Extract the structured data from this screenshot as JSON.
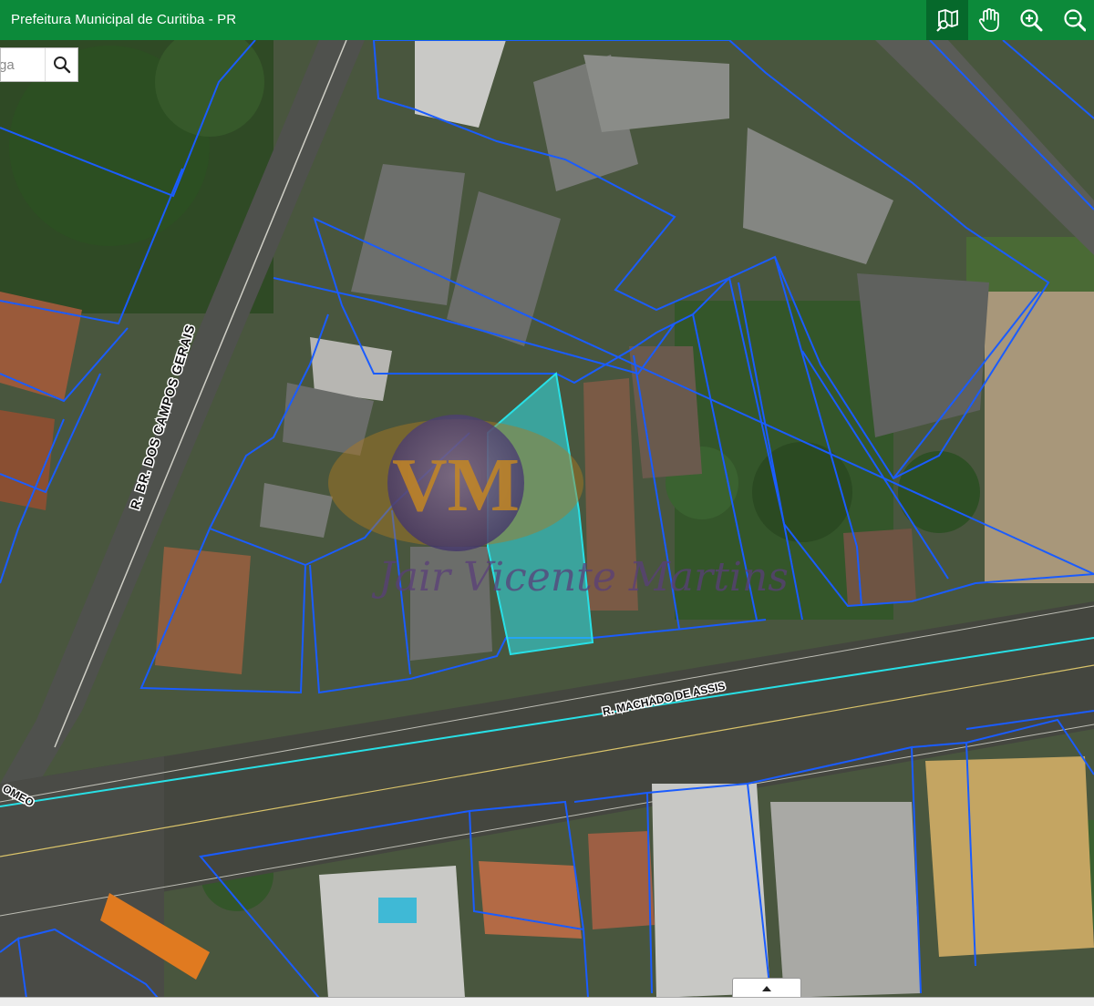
{
  "header": {
    "title": "Prefeitura Municipal de Curitiba - PR",
    "tools": [
      {
        "icon": "identify-map-icon",
        "active": true
      },
      {
        "icon": "pan-hand-icon",
        "active": false
      },
      {
        "icon": "zoom-in-icon",
        "active": false
      },
      {
        "icon": "zoom-out-icon",
        "active": false
      }
    ]
  },
  "search": {
    "value": "ga"
  },
  "map": {
    "streets": [
      {
        "name": "R. BR. DOS CAMPOS GERAIS"
      },
      {
        "name": "R. MACHADO DE ASSIS"
      },
      {
        "name": "OMEO"
      }
    ],
    "watermark": {
      "monogram": "VM",
      "script_name": "Jair Vicente Martins"
    },
    "colors": {
      "parcel_lines": "#1a5cff",
      "selected_parcel": "#28e0e6",
      "street_axis": "#28e0e6",
      "header": "#0c8a3a"
    }
  }
}
